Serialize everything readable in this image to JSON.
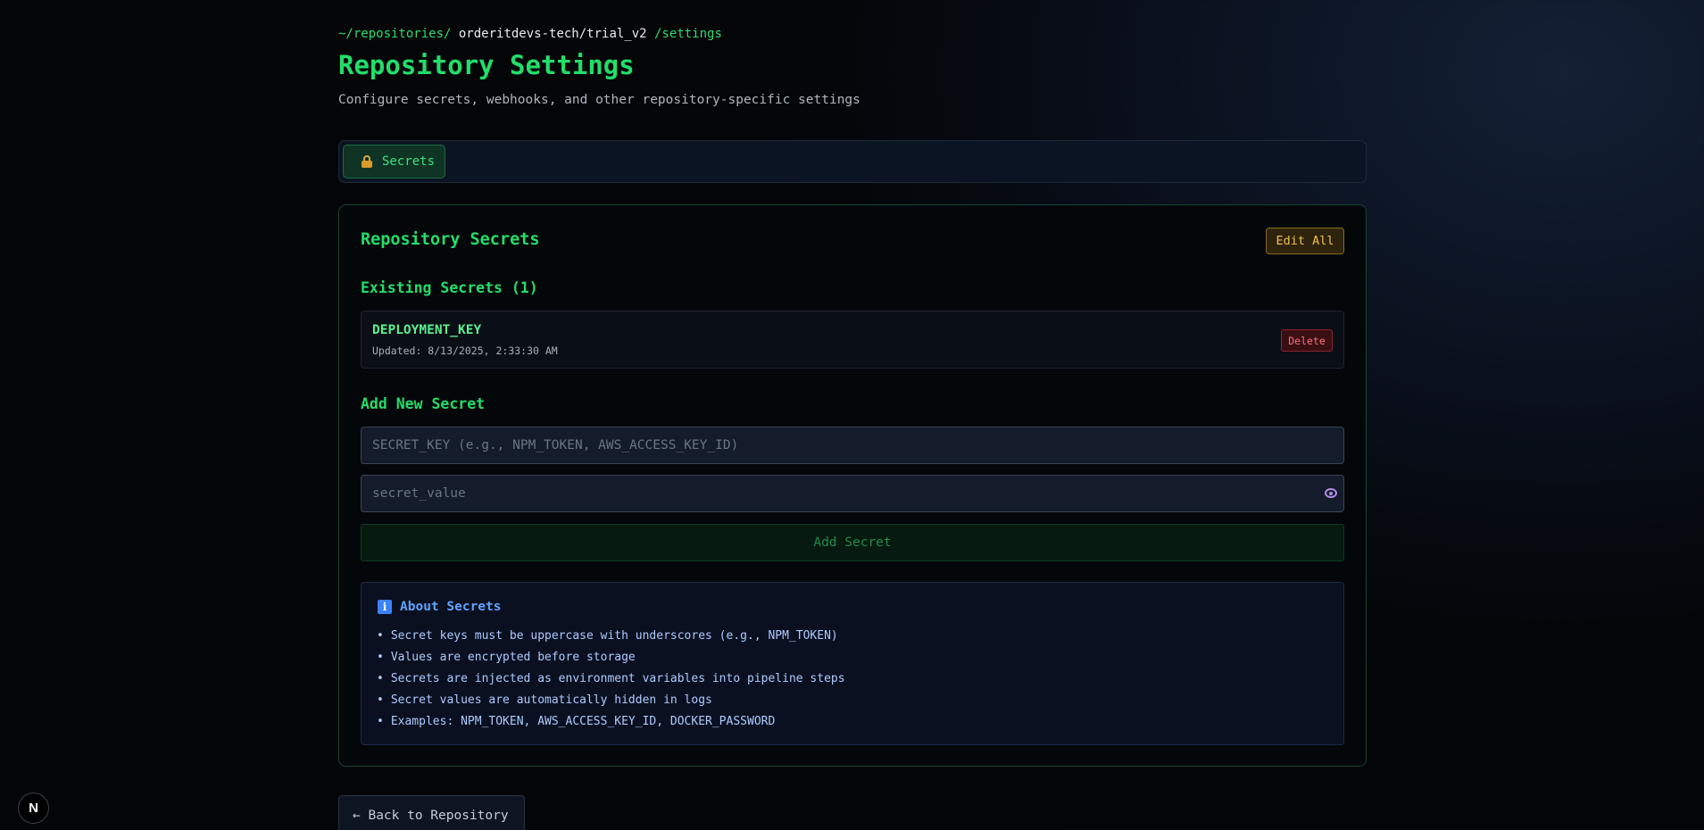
{
  "breadcrumb": {
    "prefix": "~/repositories/",
    "repo": "orderitdevs-tech/trial_v2",
    "suffix": "/settings"
  },
  "page": {
    "title": "Repository Settings",
    "subtitle": "Configure secrets, webhooks, and other repository-specific settings"
  },
  "tabs": [
    {
      "label": "Secrets",
      "icon": "lock-icon",
      "active": true
    }
  ],
  "secrets_panel": {
    "title": "Repository Secrets",
    "edit_all_label": "Edit All",
    "existing_title": "Existing Secrets (1)",
    "existing": [
      {
        "key": "DEPLOYMENT_KEY",
        "updated": "Updated: 8/13/2025, 2:33:30 AM",
        "delete_label": "Delete"
      }
    ],
    "add_title": "Add New Secret",
    "key_placeholder": "SECRET_KEY (e.g., NPM_TOKEN, AWS_ACCESS_KEY_ID)",
    "value_placeholder": "secret_value",
    "add_button_label": "Add Secret"
  },
  "about": {
    "icon": "info-icon",
    "icon_glyph": "i",
    "title": "About Secrets",
    "items": [
      "Secret keys must be uppercase with underscores (e.g., NPM_TOKEN)",
      "Values are encrypted before storage",
      "Secrets are injected as environment variables into pipeline steps",
      "Secret values are automatically hidden in logs",
      "Examples: NPM_TOKEN, AWS_ACCESS_KEY_ID, DOCKER_PASSWORD"
    ]
  },
  "back_button_label": "← Back to Repository",
  "next_badge_label": "N",
  "colors": {
    "accent_green": "#22dd6a",
    "warning": "#f2c04e",
    "danger": "#ff6b7a",
    "info": "#5ea3ff"
  }
}
